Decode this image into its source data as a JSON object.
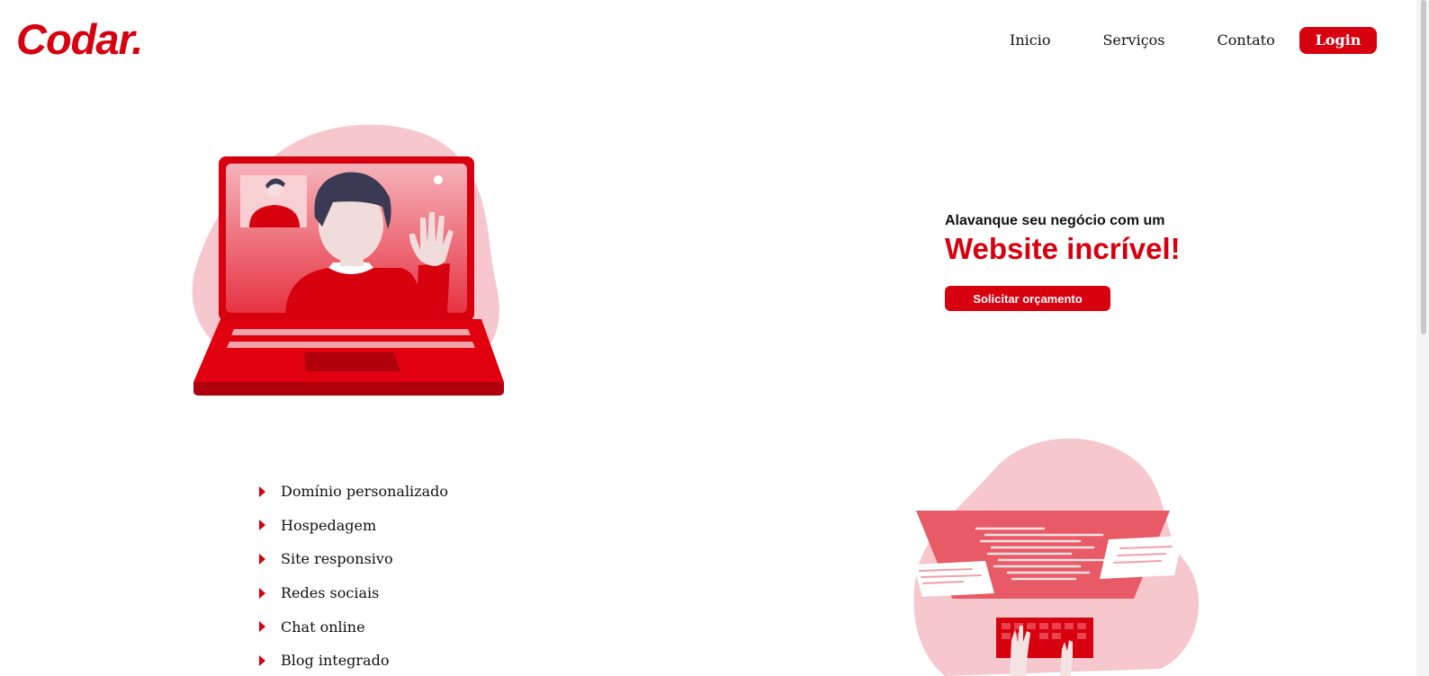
{
  "header": {
    "logo": "Codar.",
    "nav": [
      {
        "label": "Inicio"
      },
      {
        "label": "Serviços"
      },
      {
        "label": "Contato"
      }
    ],
    "login_label": "Login"
  },
  "hero": {
    "subtitle": "Alavanque seu negócio com um",
    "title": "Website incrível!",
    "cta_label": "Solicitar orçamento",
    "illustration_icon": "video-call-laptop-icon"
  },
  "features": {
    "items": [
      "Domínio personalizado",
      "Hospedagem",
      "Site responsivo",
      "Redes sociais",
      "Chat online",
      "Blog integrado"
    ],
    "illustration_icon": "developer-coding-icon"
  },
  "colors": {
    "brand": "#d7000f",
    "brand_light": "#f6c7cc",
    "text": "#111111"
  }
}
